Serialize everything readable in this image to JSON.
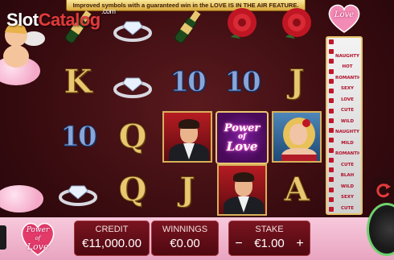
{
  "banner_text": "Improved symbols with a guaranteed win in the LOVE IS IN THE AIR FEATURE.",
  "watermark": {
    "part1": "Slot",
    "part2": "Catalog",
    "com": ".com"
  },
  "love_badge": "Love",
  "meter_words": [
    "",
    "",
    "",
    "Naughty",
    "Hot",
    "Romantic",
    "Sexy",
    "Love",
    "Cute",
    "Wild",
    "Naughty",
    "Mild",
    "Romantic",
    "Cute",
    "Blah",
    "Wild",
    "Sexy",
    "Cute"
  ],
  "reels": {
    "row1": [
      "champagne-icon",
      "diamond-ring-icon",
      "champagne-icon",
      "rose-icon",
      "rose-icon"
    ],
    "row2": {
      "c1": "K",
      "c3": "10",
      "c4": "10",
      "c5": "J"
    },
    "row3": {
      "c1": "10",
      "c2": "Q"
    },
    "row4": {
      "c2": "Q",
      "c4": "J",
      "c6": "A"
    },
    "wild_line1": "Power",
    "wild_line2": "of",
    "wild_line3": "Love"
  },
  "logo": {
    "line1": "Power",
    "line2": "of",
    "line3": "Love"
  },
  "credit": {
    "label": "CREDIT",
    "value": "€11,000.00"
  },
  "winnings": {
    "label": "WINNINGS",
    "value": "€0.00"
  },
  "stake": {
    "label": "STAKE",
    "value": "€1.00",
    "minus": "−",
    "plus": "+"
  },
  "colors": {
    "accent": "#e8c770",
    "panel": "#7a1420",
    "bar": "#f7c9dc",
    "spin_ring": "#6fd16f"
  }
}
